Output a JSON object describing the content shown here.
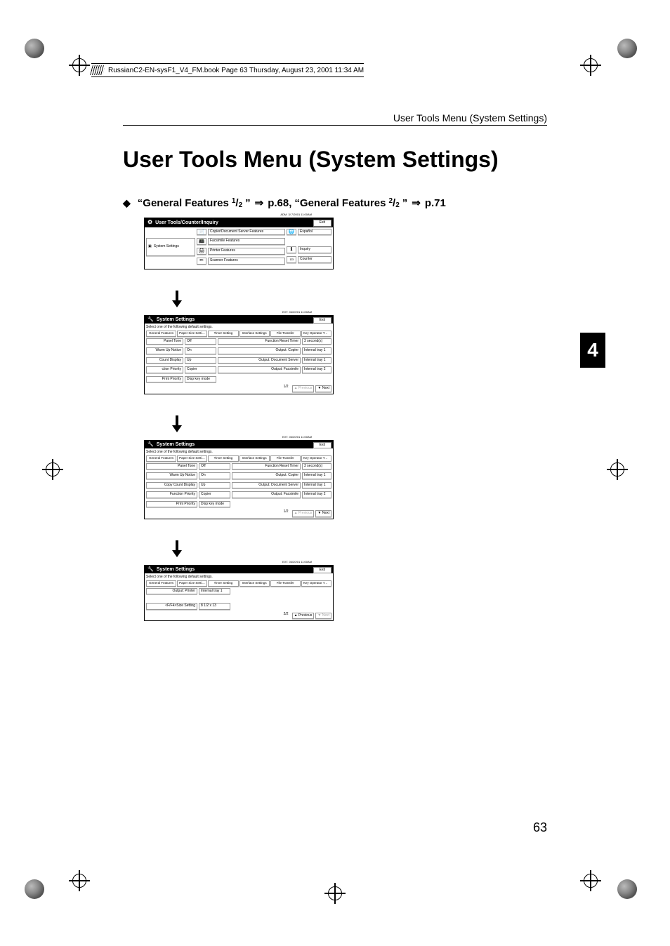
{
  "book_header": "RussianC2-EN-sysF1_V4_FM.book  Page 63  Thursday, August 23, 2001  11:34 AM",
  "running_head": "User Tools Menu (System Settings)",
  "h1": "User Tools Menu (System Settings)",
  "xref": {
    "q1": "“General Features ",
    "f1n": "1",
    "f1d": "2",
    "mid1": "”",
    "p1": " p.68,",
    "q2": "“General Features ",
    "f2n": "2",
    "f2d": "2",
    "mid2": "”",
    "p2": " p.71"
  },
  "side_tab": "4",
  "page_number": "63",
  "exit_label": "Exit",
  "date_adm": "ADM.    3/ 7/2001 11:00AM",
  "date_ext": "EXT.    04/20/01 11:00AM",
  "panel1": {
    "title": "User Tools/Counter/Inquiry",
    "left_btn": "System Settings",
    "mid_buttons": [
      "Copier/Document Server Features",
      "Facsimile Features",
      "Printer Features",
      "Scanner Features"
    ],
    "right_buttons": [
      "Español",
      "Inquiry",
      "Counter"
    ]
  },
  "settings_common": {
    "title": "System Settings",
    "sub": "Select one of the following default settings.",
    "tabs": [
      "General Features",
      "Paper Size Setting",
      "Timer Setting",
      "Interface Settings",
      "File Transfer",
      "Key Operator Tools"
    ],
    "colA_labels": [
      "Panel Tone",
      "Warm Up Notice",
      "Copy Count Display",
      "Function Priority",
      "Print Priority"
    ],
    "colA_vals": [
      "Off",
      "On",
      "Up",
      "Copier",
      "Disp key mode"
    ],
    "colB_labels": [
      "Function Reset Timer",
      "Output: Copier",
      "Output: Document Server",
      "Output: Facsimile"
    ],
    "colB_vals": [
      "3   second(s)",
      "Internal tray 1",
      "Internal tray 1",
      "Internal tray 2"
    ],
    "pager12": "1/2",
    "prev": "▲ Previous",
    "next": "▼ Next"
  },
  "panel4": {
    "rows_l": [
      "Output: Printer",
      "<F/F4>Size Setting"
    ],
    "rows_v": [
      "Internal tray 1",
      "8 1/2 x 13"
    ],
    "pager": "2/2"
  }
}
